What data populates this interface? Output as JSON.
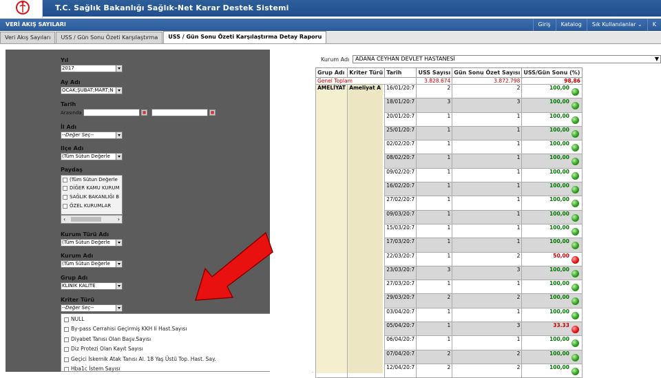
{
  "header": {
    "title": "T.C. Sağlık Bakanlığı Sağlık-Net Karar Destek Sistemi"
  },
  "nav": {
    "section_title": "VERİ AKIŞ SAYILARI",
    "links": [
      "Giriş",
      "Katalog",
      "Sık Kullanılanlar ⌄",
      "K"
    ]
  },
  "tabs": [
    "Veri Akış Sayıları",
    "USS / Gün Sonu Özeti Karşılaştırma",
    "USS / Gün Sonu Özeti Karşılaştırma Detay Raporu"
  ],
  "filters": {
    "yil_label": "Yıl",
    "yil_value": "2017",
    "ay_label": "Ay Adı",
    "ay_value": "OCAK;ŞUBAT;MART;N",
    "tarih_label": "Tarih",
    "tarih_arasinda": "Arasında",
    "il_label": "İl Adı",
    "il_value": "--Değer Seç--",
    "ilce_label": "Ilçe Adı",
    "ilce_value": "(Tüm Sütun Değerle",
    "paydas_label": "Paydaş",
    "paydas_options": [
      "(Tüm Sütun Değerle",
      "DİĞER KAMU KURUM",
      "SAĞLIK BAKANLIĞI B",
      "ÖZEL KURUMLAR"
    ],
    "kurum_turu_label": "Kurum Türü Adı",
    "kurum_turu_value": "(Tüm Sütun Değerle",
    "kurum_label": "Kurum Adı",
    "kurum_value": "(Tüm Sütun Değerle",
    "grup_label": "Grup Adı",
    "grup_value": "KLİNİK KALİTE",
    "kriter_label": "Kriter Türü",
    "kriter_value": "--Değer Seç--"
  },
  "dropdown_options": [
    "NULL",
    "By-pass Cerrahisi Geçirmiş KKH li Hast.Sayısı",
    "Diyabet Tanısı Olan Başv.Sayısı",
    "Diz Protezi Olan Kayıt Sayısı",
    "Geçici İskemik Atak Tanısı Al. 18 Yaş Üstü Top. Hast. Say.",
    "Hba1c İstem Sayısı"
  ],
  "report": {
    "kurum_label": "Kurum Adı",
    "kurum_value": "ADANA CEYHAN DEVLET HASTANESİ",
    "columns": [
      "Grup Adı",
      "Kriter Türü",
      "Tarih",
      "USS Sayısı",
      "Gün Sonu Özet Sayısı",
      "USS/Gün Sonu (%)"
    ],
    "total": {
      "label": "Genel Toplam",
      "uss": "3.828.674",
      "gso": "3.872.798",
      "pct": "98,86"
    },
    "group": "AMELİYAT",
    "kriter": "Ameliyat A",
    "rows": [
      {
        "date": "16/01/20:7",
        "uss": "2",
        "gso": "2",
        "pct": "100,00",
        "status": "green"
      },
      {
        "date": "18/01/20:7",
        "uss": "3",
        "gso": "3",
        "pct": "100,00",
        "status": "green"
      },
      {
        "date": "20/01/20:7",
        "uss": "1",
        "gso": "1",
        "pct": "100,00",
        "status": "green"
      },
      {
        "date": "25/01/20:7",
        "uss": "1",
        "gso": "1",
        "pct": "100,00",
        "status": "green"
      },
      {
        "date": "02/02/20:7",
        "uss": "1",
        "gso": "1",
        "pct": "100,00",
        "status": "green"
      },
      {
        "date": "08/02/20:7",
        "uss": "1",
        "gso": "1",
        "pct": "100,00",
        "status": "green"
      },
      {
        "date": "09/02/20:7",
        "uss": "1",
        "gso": "1",
        "pct": "100,00",
        "status": "green"
      },
      {
        "date": "16/02/20:7",
        "uss": "1",
        "gso": "1",
        "pct": "100,00",
        "status": "green"
      },
      {
        "date": "27/02/20:7",
        "uss": "1",
        "gso": "1",
        "pct": "100,00",
        "status": "green"
      },
      {
        "date": "09/03/20:7",
        "uss": "1",
        "gso": "1",
        "pct": "100,00",
        "status": "green"
      },
      {
        "date": "15/03/20:7",
        "uss": "1",
        "gso": "1",
        "pct": "100,00",
        "status": "green"
      },
      {
        "date": "17/03/20:7",
        "uss": "1",
        "gso": "1",
        "pct": "100,00",
        "status": "green"
      },
      {
        "date": "22/03/20:7",
        "uss": "1",
        "gso": "2",
        "pct": "50,00",
        "status": "red"
      },
      {
        "date": "23/03/20:7",
        "uss": "3",
        "gso": "3",
        "pct": "100,00",
        "status": "green"
      },
      {
        "date": "27/03/20:7",
        "uss": "1",
        "gso": "1",
        "pct": "100,00",
        "status": "green"
      },
      {
        "date": "29/03/20:7",
        "uss": "2",
        "gso": "2",
        "pct": "100,00",
        "status": "green"
      },
      {
        "date": "03/04/20:7",
        "uss": "1",
        "gso": "1",
        "pct": "100,00",
        "status": "green"
      },
      {
        "date": "05/04/20:7",
        "uss": "1",
        "gso": "3",
        "pct": "33.33",
        "status": "red"
      },
      {
        "date": "06/04/20:7",
        "uss": "1",
        "gso": "1",
        "pct": "100,00",
        "status": "green"
      },
      {
        "date": "07/04/20:7",
        "uss": "2",
        "gso": "2",
        "pct": "100,00",
        "status": "green"
      },
      {
        "date": "12/04/20:7",
        "uss": "2",
        "gso": "2",
        "pct": "100,00",
        "status": "green"
      }
    ]
  },
  "colors": {
    "header_blue": "#1f4f8d",
    "panel_gray": "#5c5c5c",
    "arrow_red": "#e8110f",
    "ok_green": "#2f9e1f",
    "bad_red": "#e01414"
  }
}
